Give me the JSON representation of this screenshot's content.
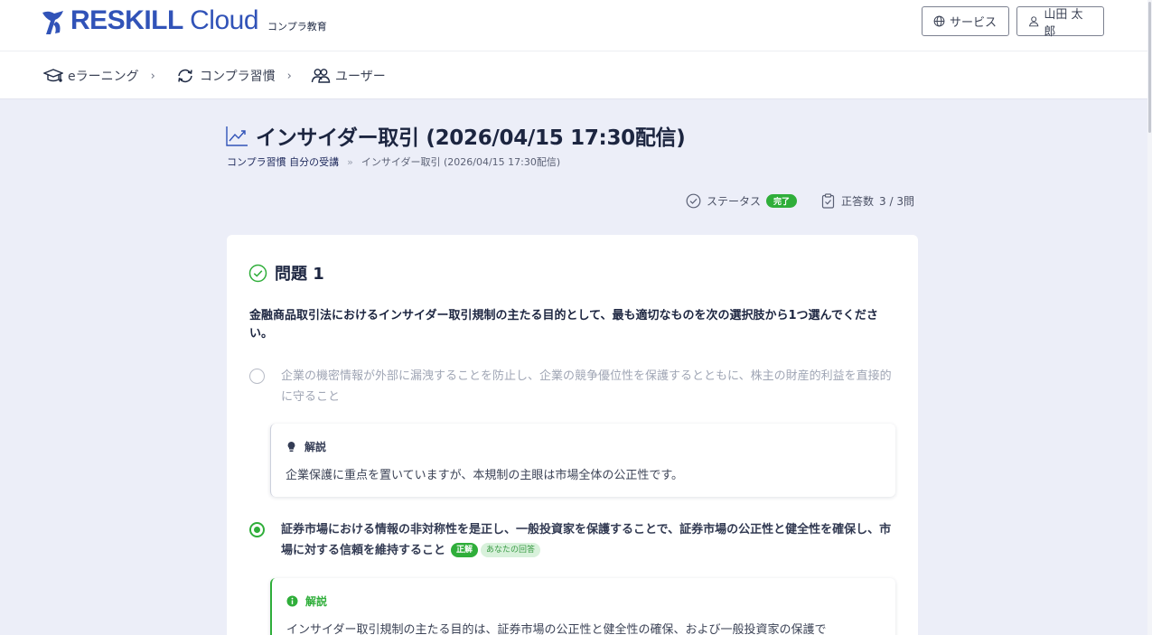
{
  "header": {
    "logo_text_bold": "RESKILL",
    "logo_text_light": "Cloud",
    "logo_sub": "コンプラ教育",
    "service_label": "サービス",
    "user_label": "山田 太郎"
  },
  "nav": {
    "items": [
      {
        "label": "eラーニング",
        "icon": "graduation-cap-icon"
      },
      {
        "label": "コンプラ習慣",
        "icon": "refresh-cycle-icon"
      },
      {
        "label": "ユーザー",
        "icon": "users-icon"
      }
    ]
  },
  "page": {
    "title": "インサイダー取引 (2026/04/15 17:30配信)",
    "breadcrumb": {
      "first": "コンプラ習慣 自分の受講",
      "separator": "»",
      "current": "インサイダー取引 (2026/04/15 17:30配信)"
    },
    "status": {
      "label": "ステータス",
      "value": "完了",
      "score_label": "正答数",
      "score_value": "3 / 3問"
    }
  },
  "question": {
    "title": "問題 1",
    "text": "金融商品取引法におけるインサイダー取引規制の主たる目的として、最も適切なものを次の選択肢から1つ選んでください。",
    "options": [
      {
        "text": "企業の機密情報が外部に漏洩することを防止し、企業の競争優位性を保護するとともに、株主の財産的利益を直接的に守ること",
        "explanation_title": "解説",
        "explanation": "企業保護に重点を置いていますが、本規制の主眼は市場全体の公正性です。"
      },
      {
        "text": "証券市場における情報の非対称性を是正し、一般投資家を保護することで、証券市場の公正性と健全性を確保し、市場に対する信頼を維持すること",
        "correct_badge": "正解",
        "answer_badge": "あなたの回答",
        "explanation_title": "解説",
        "explanation": "インサイダー取引規制の主たる目的は、証券市場の公正性と健全性の確保、および一般投資家の保護で"
      }
    ]
  },
  "colors": {
    "brand": "#3153b8",
    "success": "#2fae3a",
    "background": "#eceef8"
  }
}
